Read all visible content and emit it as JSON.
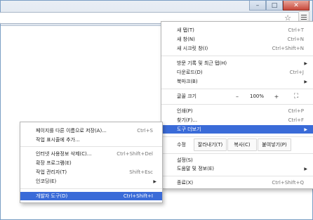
{
  "window": {
    "minimize_label": "–",
    "maximize_label": "□",
    "close_label": "✕"
  },
  "toolbar": {
    "bookmark_star": "☆"
  },
  "main_menu": {
    "items_top": [
      {
        "label": "새 탭(T)",
        "shortcut": "Ctrl+T"
      },
      {
        "label": "새 창(N)",
        "shortcut": "Ctrl+N"
      },
      {
        "label": "새 시크릿 창(I)",
        "shortcut": "Ctrl+Shift+N"
      }
    ],
    "items_history": [
      {
        "label": "방문 기록 및 최근 탭(H)",
        "arrow": "▶"
      },
      {
        "label": "다운로드(D)",
        "shortcut": "Ctrl+J"
      },
      {
        "label": "북마크(B)",
        "arrow": "▶"
      }
    ],
    "zoom": {
      "label": "글꼴 크기",
      "minus": "–",
      "value": "100%",
      "plus": "+",
      "fullscreen": "⛶"
    },
    "items_tools": [
      {
        "label": "인쇄(P)",
        "shortcut": "Ctrl+P"
      },
      {
        "label": "찾기(F)...",
        "shortcut": "Ctrl+F"
      },
      {
        "label": "도구 더보기",
        "arrow": "▶"
      }
    ],
    "edit": {
      "label": "수정",
      "cut": "잘라내기(T)",
      "copy": "복사(C)",
      "paste": "붙여넣기(P)"
    },
    "items_settings": [
      {
        "label": "설정(S)"
      },
      {
        "label": "도움말 및 정보(E)",
        "arrow": "▶"
      }
    ],
    "exit": {
      "label": "종료(X)",
      "shortcut": "Ctrl+Shift+Q"
    }
  },
  "submenu": {
    "items_a": [
      {
        "label": "페이지를 다른 이름으로 저장(A)...",
        "shortcut": "Ctrl+S"
      },
      {
        "label": "작업 표시줄에 추가..."
      }
    ],
    "items_b": [
      {
        "label": "인터넷 사용정보 삭제(C)...",
        "shortcut": "Ctrl+Shift+Del"
      },
      {
        "label": "확장 프로그램(E)"
      },
      {
        "label": "작업 관리자(T)",
        "shortcut": "Shift+Esc"
      },
      {
        "label": "인코딩(E)",
        "arrow": "▶"
      }
    ],
    "items_c": [
      {
        "label": "개발자 도구(D)",
        "shortcut": "Ctrl+Shift+I"
      }
    ]
  },
  "colors": {
    "highlight": "#3a6bd8"
  }
}
